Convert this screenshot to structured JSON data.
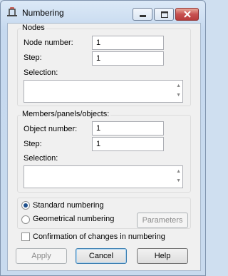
{
  "window": {
    "title": "Numbering"
  },
  "nodes": {
    "legend": "Nodes",
    "number_label": "Node number:",
    "number_value": "1",
    "step_label": "Step:",
    "step_value": "1",
    "selection_label": "Selection:"
  },
  "members": {
    "legend": "Members/panels/objects:",
    "number_label": "Object number:",
    "number_value": "1",
    "step_label": "Step:",
    "step_value": "1",
    "selection_label": "Selection:"
  },
  "numbering": {
    "standard_label": "Standard numbering",
    "standard_selected": true,
    "geometrical_label": "Geometrical numbering",
    "parameters_label": "Parameters"
  },
  "confirmation": {
    "label": "Confirmation of changes in numbering",
    "checked": false
  },
  "buttons": {
    "apply": "Apply",
    "cancel": "Cancel",
    "help": "Help"
  },
  "icons": {
    "app": "numbering-app-icon",
    "minimize": "minimize-icon",
    "maximize": "maximize-icon",
    "close": "close-icon",
    "scroll_up": "scroll-up-arrow-icon",
    "scroll_down": "scroll-down-arrow-icon"
  }
}
